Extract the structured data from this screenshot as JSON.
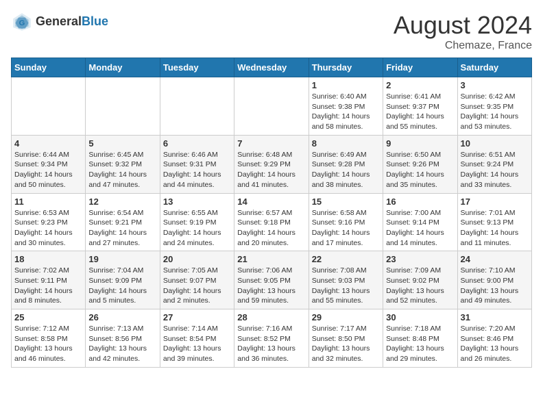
{
  "header": {
    "logo_general": "General",
    "logo_blue": "Blue",
    "month_year": "August 2024",
    "location": "Chemaze, France"
  },
  "weekdays": [
    "Sunday",
    "Monday",
    "Tuesday",
    "Wednesday",
    "Thursday",
    "Friday",
    "Saturday"
  ],
  "weeks": [
    [
      {
        "day": "",
        "sunrise": "",
        "sunset": "",
        "daylight": ""
      },
      {
        "day": "",
        "sunrise": "",
        "sunset": "",
        "daylight": ""
      },
      {
        "day": "",
        "sunrise": "",
        "sunset": "",
        "daylight": ""
      },
      {
        "day": "",
        "sunrise": "",
        "sunset": "",
        "daylight": ""
      },
      {
        "day": "1",
        "sunrise": "Sunrise: 6:40 AM",
        "sunset": "Sunset: 9:38 PM",
        "daylight": "Daylight: 14 hours and 58 minutes."
      },
      {
        "day": "2",
        "sunrise": "Sunrise: 6:41 AM",
        "sunset": "Sunset: 9:37 PM",
        "daylight": "Daylight: 14 hours and 55 minutes."
      },
      {
        "day": "3",
        "sunrise": "Sunrise: 6:42 AM",
        "sunset": "Sunset: 9:35 PM",
        "daylight": "Daylight: 14 hours and 53 minutes."
      }
    ],
    [
      {
        "day": "4",
        "sunrise": "Sunrise: 6:44 AM",
        "sunset": "Sunset: 9:34 PM",
        "daylight": "Daylight: 14 hours and 50 minutes."
      },
      {
        "day": "5",
        "sunrise": "Sunrise: 6:45 AM",
        "sunset": "Sunset: 9:32 PM",
        "daylight": "Daylight: 14 hours and 47 minutes."
      },
      {
        "day": "6",
        "sunrise": "Sunrise: 6:46 AM",
        "sunset": "Sunset: 9:31 PM",
        "daylight": "Daylight: 14 hours and 44 minutes."
      },
      {
        "day": "7",
        "sunrise": "Sunrise: 6:48 AM",
        "sunset": "Sunset: 9:29 PM",
        "daylight": "Daylight: 14 hours and 41 minutes."
      },
      {
        "day": "8",
        "sunrise": "Sunrise: 6:49 AM",
        "sunset": "Sunset: 9:28 PM",
        "daylight": "Daylight: 14 hours and 38 minutes."
      },
      {
        "day": "9",
        "sunrise": "Sunrise: 6:50 AM",
        "sunset": "Sunset: 9:26 PM",
        "daylight": "Daylight: 14 hours and 35 minutes."
      },
      {
        "day": "10",
        "sunrise": "Sunrise: 6:51 AM",
        "sunset": "Sunset: 9:24 PM",
        "daylight": "Daylight: 14 hours and 33 minutes."
      }
    ],
    [
      {
        "day": "11",
        "sunrise": "Sunrise: 6:53 AM",
        "sunset": "Sunset: 9:23 PM",
        "daylight": "Daylight: 14 hours and 30 minutes."
      },
      {
        "day": "12",
        "sunrise": "Sunrise: 6:54 AM",
        "sunset": "Sunset: 9:21 PM",
        "daylight": "Daylight: 14 hours and 27 minutes."
      },
      {
        "day": "13",
        "sunrise": "Sunrise: 6:55 AM",
        "sunset": "Sunset: 9:19 PM",
        "daylight": "Daylight: 14 hours and 24 minutes."
      },
      {
        "day": "14",
        "sunrise": "Sunrise: 6:57 AM",
        "sunset": "Sunset: 9:18 PM",
        "daylight": "Daylight: 14 hours and 20 minutes."
      },
      {
        "day": "15",
        "sunrise": "Sunrise: 6:58 AM",
        "sunset": "Sunset: 9:16 PM",
        "daylight": "Daylight: 14 hours and 17 minutes."
      },
      {
        "day": "16",
        "sunrise": "Sunrise: 7:00 AM",
        "sunset": "Sunset: 9:14 PM",
        "daylight": "Daylight: 14 hours and 14 minutes."
      },
      {
        "day": "17",
        "sunrise": "Sunrise: 7:01 AM",
        "sunset": "Sunset: 9:13 PM",
        "daylight": "Daylight: 14 hours and 11 minutes."
      }
    ],
    [
      {
        "day": "18",
        "sunrise": "Sunrise: 7:02 AM",
        "sunset": "Sunset: 9:11 PM",
        "daylight": "Daylight: 14 hours and 8 minutes."
      },
      {
        "day": "19",
        "sunrise": "Sunrise: 7:04 AM",
        "sunset": "Sunset: 9:09 PM",
        "daylight": "Daylight: 14 hours and 5 minutes."
      },
      {
        "day": "20",
        "sunrise": "Sunrise: 7:05 AM",
        "sunset": "Sunset: 9:07 PM",
        "daylight": "Daylight: 14 hours and 2 minutes."
      },
      {
        "day": "21",
        "sunrise": "Sunrise: 7:06 AM",
        "sunset": "Sunset: 9:05 PM",
        "daylight": "Daylight: 13 hours and 59 minutes."
      },
      {
        "day": "22",
        "sunrise": "Sunrise: 7:08 AM",
        "sunset": "Sunset: 9:03 PM",
        "daylight": "Daylight: 13 hours and 55 minutes."
      },
      {
        "day": "23",
        "sunrise": "Sunrise: 7:09 AM",
        "sunset": "Sunset: 9:02 PM",
        "daylight": "Daylight: 13 hours and 52 minutes."
      },
      {
        "day": "24",
        "sunrise": "Sunrise: 7:10 AM",
        "sunset": "Sunset: 9:00 PM",
        "daylight": "Daylight: 13 hours and 49 minutes."
      }
    ],
    [
      {
        "day": "25",
        "sunrise": "Sunrise: 7:12 AM",
        "sunset": "Sunset: 8:58 PM",
        "daylight": "Daylight: 13 hours and 46 minutes."
      },
      {
        "day": "26",
        "sunrise": "Sunrise: 7:13 AM",
        "sunset": "Sunset: 8:56 PM",
        "daylight": "Daylight: 13 hours and 42 minutes."
      },
      {
        "day": "27",
        "sunrise": "Sunrise: 7:14 AM",
        "sunset": "Sunset: 8:54 PM",
        "daylight": "Daylight: 13 hours and 39 minutes."
      },
      {
        "day": "28",
        "sunrise": "Sunrise: 7:16 AM",
        "sunset": "Sunset: 8:52 PM",
        "daylight": "Daylight: 13 hours and 36 minutes."
      },
      {
        "day": "29",
        "sunrise": "Sunrise: 7:17 AM",
        "sunset": "Sunset: 8:50 PM",
        "daylight": "Daylight: 13 hours and 32 minutes."
      },
      {
        "day": "30",
        "sunrise": "Sunrise: 7:18 AM",
        "sunset": "Sunset: 8:48 PM",
        "daylight": "Daylight: 13 hours and 29 minutes."
      },
      {
        "day": "31",
        "sunrise": "Sunrise: 7:20 AM",
        "sunset": "Sunset: 8:46 PM",
        "daylight": "Daylight: 13 hours and 26 minutes."
      }
    ]
  ]
}
